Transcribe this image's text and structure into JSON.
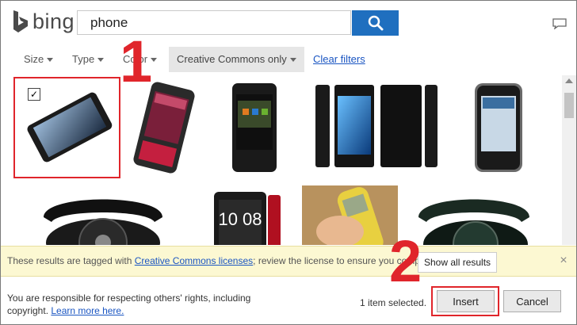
{
  "header": {
    "logo_text": "bing",
    "search_value": "phone",
    "search_icon": "search-icon",
    "feedback_icon": "speech-bubble-icon"
  },
  "filters": {
    "size": "Size",
    "type": "Type",
    "color": "Color",
    "license": "Creative Commons only",
    "clear": "Clear filters"
  },
  "results": {
    "row1": [
      "phone-lg-black",
      "phone-lg-red",
      "phone-boost-mobile",
      "phone-sony-xperia",
      "phone-zte-silver"
    ],
    "row2": [
      "rotary-phone-black",
      "phone-htc-red",
      "nokia-phone-hand",
      "rotary-phone-green"
    ],
    "selected_check": "✓"
  },
  "license_bar": {
    "text_before": "These results are tagged with ",
    "link": "Creative Commons licenses",
    "text_after": "; review the license to ensure you compl",
    "show_all": "Show all results",
    "close": "×"
  },
  "footer": {
    "note_line1": "You are responsible for respecting others' rights, including",
    "note_line2": "copyright.",
    "learn_more": "Learn more here.",
    "selected_count": "1 item selected.",
    "insert": "Insert",
    "cancel": "Cancel"
  },
  "annotations": {
    "step1": "1",
    "step2": "2"
  },
  "colors": {
    "accent_blue": "#1f6fbf",
    "annotation_red": "#e0252b",
    "license_bar_bg": "#fcf8d2"
  }
}
